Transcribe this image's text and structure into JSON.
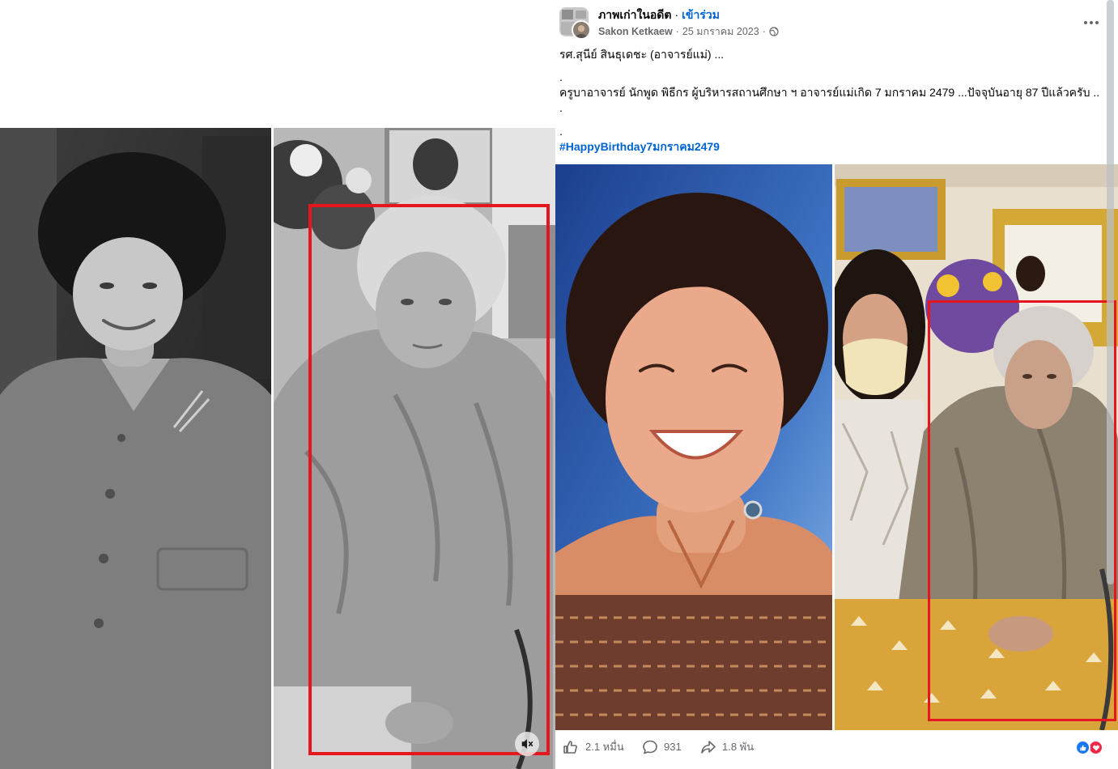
{
  "colors": {
    "text": "#050505",
    "secondary_text": "#65676B",
    "link": "#0064D1",
    "highlight_box": "#E5161D",
    "like_reaction": "#1877F2",
    "love_reaction": "#F0284A"
  },
  "left_media": {
    "mute_icon": "speaker-muted-icon"
  },
  "post": {
    "group_name": "ภาพเก่าในอดีต",
    "separator": "·",
    "join_label": "เข้าร่วม",
    "author": "Sakon Ketkaew",
    "date": "25 มกราคม 2023",
    "privacy_icon": "globe-icon",
    "menu_icon": "more-horizontal-icon",
    "text_lines": [
      "รศ.สุนีย์ สินธุเดชะ (อาจารย์แม่) ...",
      ".",
      "ครูบาอาจารย์ นักพูด พิธีกร ผู้บริหารสถานศึกษา ฯ อาจารย์แม่เกิด 7 มกราคม 2479 ...ปัจจุบันอายุ 87 ปีแล้วครับ ..",
      ".",
      "."
    ],
    "hashtag": "#HappyBirthday7มกราคม2479"
  },
  "footer": {
    "like_icon": "thumbs-up-icon",
    "like_count": "2.1 หมื่น",
    "comment_icon": "comment-icon",
    "comment_count": "931",
    "share_icon": "share-icon",
    "share_count": "1.8 พัน",
    "reaction_icons": [
      "like-reaction-icon",
      "love-reaction-icon"
    ]
  }
}
